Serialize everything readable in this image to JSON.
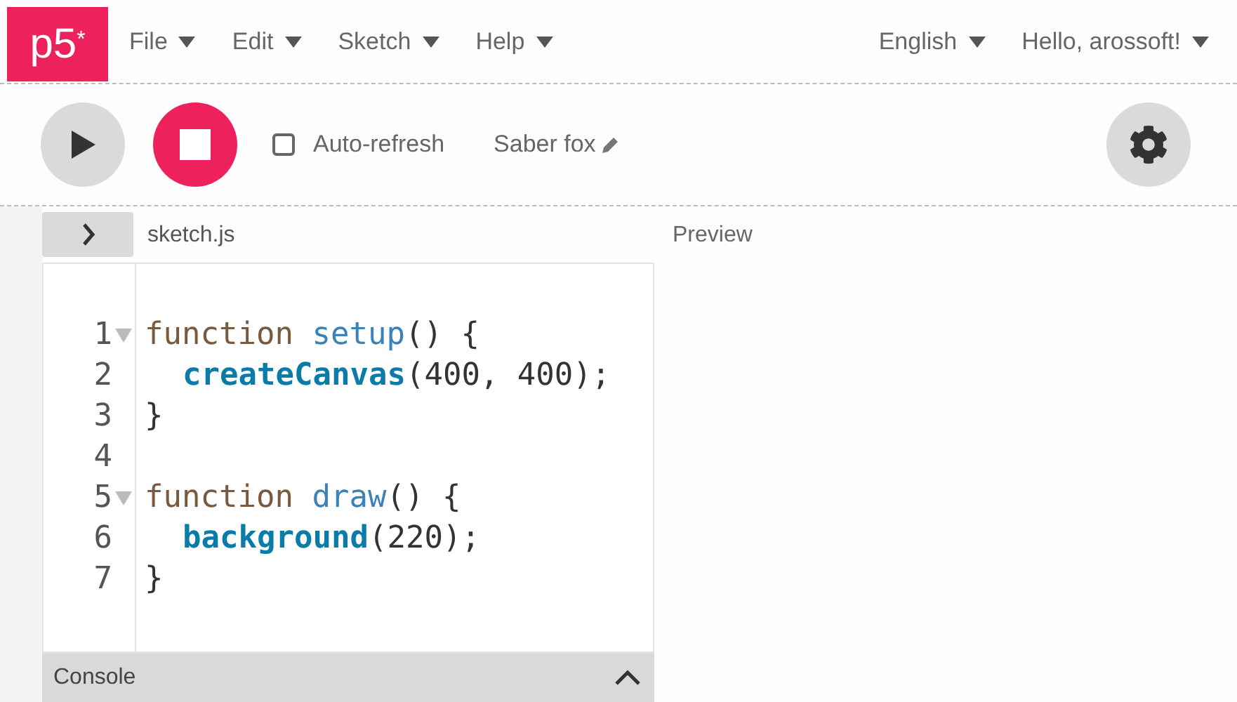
{
  "logo": {
    "text": "p5",
    "mark": "*"
  },
  "menu": [
    {
      "label": "File"
    },
    {
      "label": "Edit"
    },
    {
      "label": "Sketch"
    },
    {
      "label": "Help"
    }
  ],
  "right_menu": [
    {
      "label": "English"
    },
    {
      "label": "Hello, arossoft!"
    }
  ],
  "toolbar": {
    "auto_refresh": {
      "label": "Auto-refresh",
      "checked": false
    },
    "sketch_name": "Saber fox"
  },
  "editor": {
    "file_name": "sketch.js",
    "lines": [
      {
        "number": "1",
        "foldable": true,
        "indented": false,
        "tokens": [
          {
            "kind": "keyword",
            "text": "function"
          },
          {
            "kind": "def",
            "text": " setup"
          },
          {
            "kind": "plain",
            "text": "() {"
          }
        ]
      },
      {
        "number": "2",
        "foldable": false,
        "indented": true,
        "tokens": [
          {
            "kind": "builtin",
            "text": "createCanvas"
          },
          {
            "kind": "plain",
            "text": "(400, 400);"
          }
        ]
      },
      {
        "number": "3",
        "foldable": false,
        "indented": false,
        "tokens": [
          {
            "kind": "plain",
            "text": "}"
          }
        ]
      },
      {
        "number": "4",
        "foldable": false,
        "indented": false
      },
      {
        "number": "5",
        "foldable": true,
        "indented": false,
        "tokens": [
          {
            "kind": "keyword",
            "text": "function"
          },
          {
            "kind": "def",
            "text": " draw"
          },
          {
            "kind": "plain",
            "text": "() {"
          }
        ]
      },
      {
        "number": "6",
        "foldable": false,
        "indented": true,
        "tokens": [
          {
            "kind": "builtin",
            "text": "background"
          },
          {
            "kind": "plain",
            "text": "(220);"
          }
        ]
      },
      {
        "number": "7",
        "foldable": false,
        "indented": false,
        "tokens": [
          {
            "kind": "plain",
            "text": "}"
          }
        ]
      }
    ]
  },
  "preview": {
    "label": "Preview"
  },
  "console": {
    "label": "Console"
  }
}
